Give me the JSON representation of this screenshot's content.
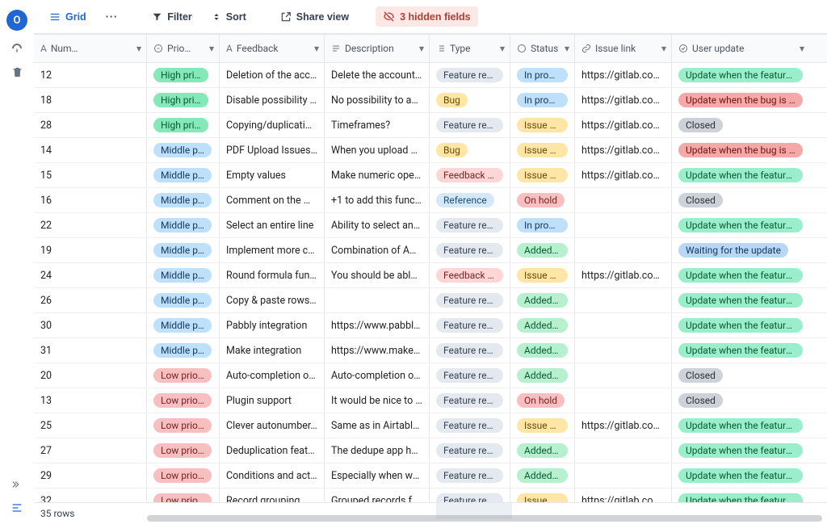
{
  "avatar_letter": "O",
  "toolbar": {
    "grid": "Grid",
    "more": "···",
    "filter": "Filter",
    "sort": "Sort",
    "share": "Share view",
    "hidden": "3 hidden fields"
  },
  "columns": {
    "num": "Num…",
    "prio": "Prio…",
    "feedback": "Feedback",
    "description": "Description",
    "type": "Type",
    "status": "Status",
    "link": "Issue link",
    "update": "User update"
  },
  "footer": {
    "row_count": "35 rows"
  },
  "type_labels": {
    "fr": "Feature requ…",
    "bug": "Bug",
    "fbo": "Feedback on…",
    "ref": "Reference"
  },
  "status_labels": {
    "inprog": "In progr…",
    "issuec": "Issue cre…",
    "onhold": "On hold",
    "added": "Added t…"
  },
  "update_labels": {
    "ufeat": "Update when the feature i…",
    "ubug": "Update when the bug is fix…",
    "closed": "Closed",
    "wait": "Waiting for the update"
  },
  "prio_labels": {
    "high": "High pri…",
    "middle": "Middle p…",
    "low": "Low prio…"
  },
  "rows": [
    {
      "n": "12",
      "p": "high",
      "fb": "Deletion of the acc…",
      "d": "Delete the account i…",
      "t": "fr",
      "s": "inprog",
      "l": "https://gitlab.com…",
      "u": "ufeat"
    },
    {
      "n": "18",
      "p": "high",
      "fb": "Disable possibility t…",
      "d": "No possibility to ad…",
      "t": "bug",
      "s": "inprog",
      "l": "https://gitlab.com…",
      "u": "ubug"
    },
    {
      "n": "28",
      "p": "high",
      "fb": "Copying/duplicatin…",
      "d": "Timeframes?",
      "t": "fr",
      "s": "issuec",
      "l": "https://gitlab.com…",
      "u": "closed"
    },
    {
      "n": "14",
      "p": "middle",
      "fb": "PDF Upload Issues …",
      "d": "When you upload a …",
      "t": "bug",
      "s": "issuec",
      "l": "https://gitlab.com…",
      "u": "ubug"
    },
    {
      "n": "15",
      "p": "middle",
      "fb": "Empty values",
      "d": "Make numeric oper…",
      "t": "fbo",
      "s": "issuec",
      "l": "https://gitlab.com…",
      "u": "ufeat"
    },
    {
      "n": "16",
      "p": "middle",
      "fb": "Comment on the M…",
      "d": "+1 to add this functi…",
      "t": "ref",
      "s": "onhold",
      "l": "",
      "u": "closed"
    },
    {
      "n": "22",
      "p": "middle",
      "fb": "Select an entire line",
      "d": "Ability to select an e…",
      "t": "fr",
      "s": "inprog",
      "l": "",
      "u": "ufeat"
    },
    {
      "n": "19",
      "p": "middle",
      "fb": "Implement more co…",
      "d": "Combination of AN…",
      "t": "fr",
      "s": "added",
      "l": "",
      "u": "wait"
    },
    {
      "n": "24",
      "p": "middle",
      "fb": "Round formula fun…",
      "d": "You should be able …",
      "t": "fbo",
      "s": "issuec",
      "l": "https://gitlab.com…",
      "u": "ufeat"
    },
    {
      "n": "26",
      "p": "middle",
      "fb": "Copy & paste rows …",
      "d": "",
      "t": "fr",
      "s": "added",
      "l": "",
      "u": "ufeat"
    },
    {
      "n": "30",
      "p": "middle",
      "fb": "Pabbly integration",
      "d": "https://www.pabbly.…",
      "t": "fr",
      "s": "added",
      "l": "",
      "u": "ufeat"
    },
    {
      "n": "31",
      "p": "middle",
      "fb": "Make integration",
      "d": "https://www.make.c…",
      "t": "fr",
      "s": "added",
      "l": "",
      "u": "ufeat"
    },
    {
      "n": "20",
      "p": "low",
      "fb": "Auto-completion of…",
      "d": "Auto-completion of …",
      "t": "fr",
      "s": "added",
      "l": "",
      "u": "closed"
    },
    {
      "n": "13",
      "p": "low",
      "fb": "Plugin support",
      "d": "It would be nice to …",
      "t": "fr",
      "s": "onhold",
      "l": "",
      "u": "closed"
    },
    {
      "n": "25",
      "p": "low",
      "fb": "Clever autonumber…",
      "d": "Same as in Airtable:…",
      "t": "fr",
      "s": "issuec",
      "l": "https://gitlab.com…",
      "u": "ufeat"
    },
    {
      "n": "27",
      "p": "low",
      "fb": "Deduplication featu…",
      "d": "The dedupe app hel…",
      "t": "fr",
      "s": "added",
      "l": "",
      "u": "ufeat"
    },
    {
      "n": "29",
      "p": "low",
      "fb": "Conditions and acti…",
      "d": "Especially when we…",
      "t": "fr",
      "s": "added",
      "l": "",
      "u": "ufeat"
    },
    {
      "n": "32",
      "p": "low",
      "fb": "Record grouping",
      "d": "Grouped records fe…",
      "t": "fr",
      "s": "issuec",
      "l": "https://gitlab.com…",
      "u": "ufeat"
    }
  ]
}
